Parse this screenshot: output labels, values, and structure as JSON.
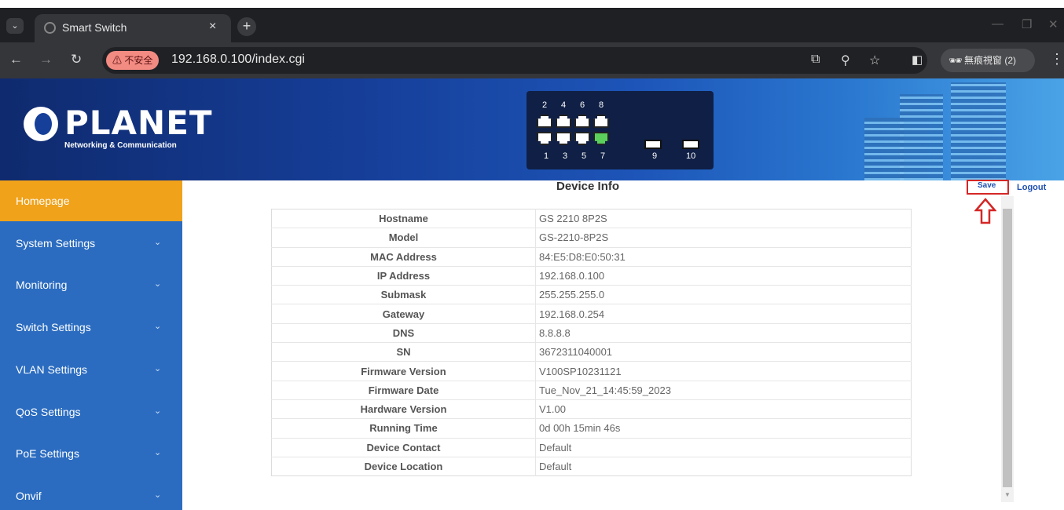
{
  "browser": {
    "tab_title": "Smart Switch",
    "tab_close": "×",
    "new_tab": "+",
    "insecure_label": "不安全",
    "url": "192.168.0.100/index.cgi",
    "incognito_label": "無痕視窗 (2)"
  },
  "banner": {
    "logo": "PLANET",
    "logo_sub": "Networking & Communication",
    "ports_top": [
      "2",
      "4",
      "6",
      "8"
    ],
    "ports_bottom": [
      "1",
      "3",
      "5",
      "7"
    ],
    "sfp_ports": [
      "9",
      "10"
    ],
    "active_port": "7"
  },
  "sidebar": {
    "items": [
      {
        "label": "Homepage"
      },
      {
        "label": "System Settings"
      },
      {
        "label": "Monitoring"
      },
      {
        "label": "Switch Settings"
      },
      {
        "label": "VLAN Settings"
      },
      {
        "label": "QoS Settings"
      },
      {
        "label": "PoE Settings"
      },
      {
        "label": "Onvif"
      }
    ]
  },
  "content": {
    "title": "Device Info",
    "save": "Save",
    "logout": "Logout",
    "rows": [
      {
        "key": "Hostname",
        "value": "GS 2210 8P2S"
      },
      {
        "key": "Model",
        "value": "GS-2210-8P2S"
      },
      {
        "key": "MAC Address",
        "value": "84:E5:D8:E0:50:31"
      },
      {
        "key": "IP Address",
        "value": "192.168.0.100"
      },
      {
        "key": "Submask",
        "value": "255.255.255.0"
      },
      {
        "key": "Gateway",
        "value": "192.168.0.254"
      },
      {
        "key": "DNS",
        "value": "8.8.8.8"
      },
      {
        "key": "SN",
        "value": "3672311040001"
      },
      {
        "key": "Firmware Version",
        "value": "V100SP10231121"
      },
      {
        "key": "Firmware Date",
        "value": "Tue_Nov_21_14:45:59_2023"
      },
      {
        "key": "Hardware Version",
        "value": "V1.00"
      },
      {
        "key": "Running Time",
        "value": "0d 00h 15min 46s"
      },
      {
        "key": "Device Contact",
        "value": "Default"
      },
      {
        "key": "Device Location",
        "value": "Default"
      }
    ]
  },
  "colors": {
    "sidebar": "#2b6cc0",
    "active_menu": "#f0a21a",
    "highlight": "#d42626"
  }
}
